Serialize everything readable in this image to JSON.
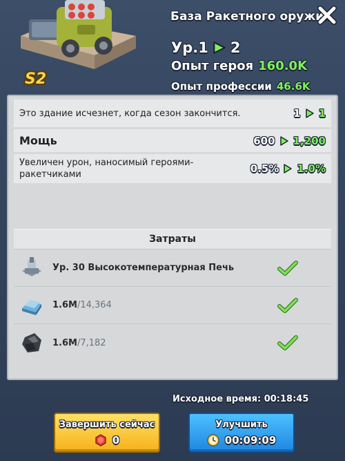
{
  "header": {
    "title": "База Ракетного оружия",
    "season_badge": "S2",
    "level_label": "Ур.1",
    "level_next": "2",
    "hero_xp_label": "Опыт героя",
    "hero_xp_value": "160.0K",
    "prof_xp_label": "Опыт профессии",
    "prof_xp_value": "46.6K"
  },
  "stats": [
    {
      "label": "Это здание исчезнет, когда сезон закончится.",
      "old": "1",
      "new": "1"
    },
    {
      "label": "Мощь",
      "old": "600",
      "new": "1,200"
    },
    {
      "label": "Увеличен урон, наносимый героями-ракетчиками",
      "old": "0.5%",
      "new": "1.0%"
    }
  ],
  "costs": {
    "header": "Затраты",
    "items": [
      {
        "icon": "furnace-icon",
        "text": "Ур. 30 Высокотемпературная Печь"
      },
      {
        "icon": "iron-ingot-icon",
        "have": "1.6M",
        "need": "/14,364"
      },
      {
        "icon": "coal-ore-icon",
        "have": "1.6M",
        "need": "/7,182"
      }
    ]
  },
  "footer": {
    "initial_time_label": "Исходное время:",
    "initial_time_value": "00:18:45",
    "finish_label": "Завершить сейчас",
    "finish_cost": "0",
    "upgrade_label": "Улучшить",
    "upgrade_time": "00:09:09"
  },
  "colors": {
    "accent_green": "#7ff05a",
    "finish_button": "#f6b11a",
    "upgrade_button": "#1f86e0"
  }
}
